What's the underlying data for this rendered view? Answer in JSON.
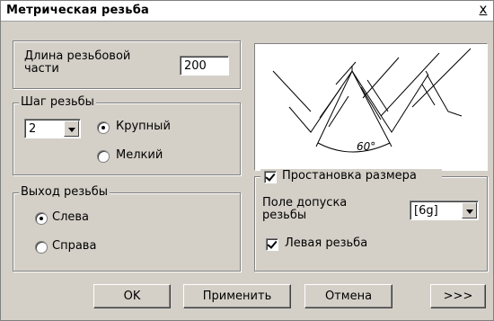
{
  "window": {
    "title": "Метрическая резьба",
    "close_glyph": "x"
  },
  "length": {
    "label": "Длина резьбовой части",
    "value": "200"
  },
  "pitch": {
    "group_label": "Шаг резьбы",
    "value": "2",
    "options": [
      {
        "label": "Крупный",
        "selected": true
      },
      {
        "label": "Мелкий",
        "selected": false
      }
    ]
  },
  "exit": {
    "group_label": "Выход резьбы",
    "options": [
      {
        "label": "Слева",
        "selected": true
      },
      {
        "label": "Справа",
        "selected": false
      }
    ]
  },
  "preview": {
    "angle_label": "60°"
  },
  "dimension": {
    "checkbox_label": "Простановка размера",
    "checked": true,
    "tolerance_label": "Поле допуска резьбы",
    "tolerance_value": "[6g]",
    "left_thread_label": "Левая резьба",
    "left_thread_checked": true
  },
  "buttons": {
    "ok": "OK",
    "apply": "Применить",
    "cancel": "Отмена",
    "more": ">>>"
  }
}
